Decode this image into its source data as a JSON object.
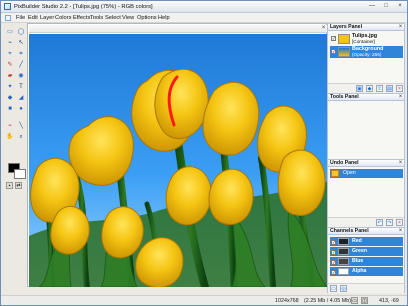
{
  "app": {
    "title": "PixBuilder Studio 2.2 - [Tulips.jpg (75%) - RGB colors]"
  },
  "window_controls": {
    "minimize": "—",
    "maximize": "□",
    "close": "×"
  },
  "menu": {
    "items": [
      "File",
      "Edit",
      "Layer",
      "Colors",
      "Effects",
      "Tools",
      "Select",
      "View",
      "Options",
      "Help"
    ]
  },
  "icons": {
    "app": "app-window-icon",
    "document": "document-icon",
    "tools": [
      "selection-icon",
      "lasso-icon",
      "move-icon",
      "pencil-icon",
      "brush-icon",
      "eraser-icon",
      "clone-icon",
      "text-icon",
      "fill-icon",
      "shape-icon",
      "zoom-icon",
      "eyedropper-icon"
    ]
  },
  "canvas": {
    "document_close": "×",
    "sky_color": "#2f8ee8",
    "petal_color": "#f4c20d",
    "stem_color": "#1b5b18",
    "highlight_color": "#ff1a1a"
  },
  "layers_panel": {
    "title": "Layers Panel",
    "close": "×",
    "rows": [
      {
        "name": "Tulips.jpg",
        "sub": "[Container]",
        "checked": "✓"
      },
      {
        "name": "Background",
        "sub": "(Opacity: 256)",
        "checked": "✓"
      }
    ]
  },
  "tools_panel": {
    "title": "Tools Panel",
    "close": "×"
  },
  "undo_panel": {
    "title": "Undo Panel",
    "close": "×",
    "item": "Open"
  },
  "channels_panel": {
    "title": "Channels Panel",
    "close": "×",
    "items": [
      "Red",
      "Green",
      "Blue",
      "Alpha"
    ],
    "checked": "✓"
  },
  "status": {
    "dimensions": "1024x768",
    "memory": "(2.25 Mb / 4.05 Mb)",
    "coords": "413, -69"
  }
}
